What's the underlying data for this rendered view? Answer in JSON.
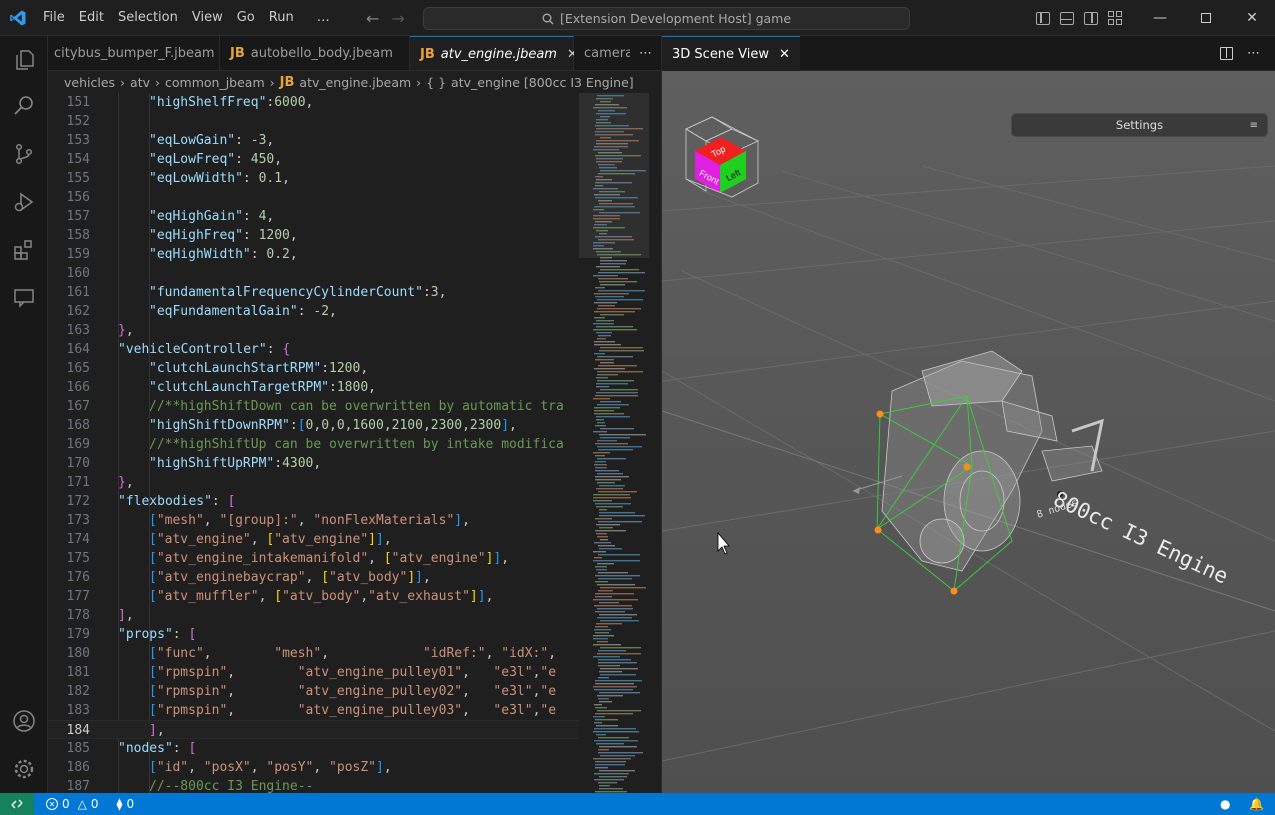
{
  "titlebar": {
    "menu": [
      "File",
      "Edit",
      "Selection",
      "View",
      "Go",
      "Run",
      "…"
    ],
    "command_center": "[Extension Development Host] game"
  },
  "editor": {
    "tabs": [
      {
        "label": "citybus_bumper_F.jbeam",
        "icon": "JB"
      },
      {
        "label": "autobello_body.jbeam",
        "icon": "JB"
      },
      {
        "label": "atv_engine.jbeam",
        "icon": "JB"
      },
      {
        "label": "camera",
        "icon": ""
      }
    ],
    "breadcrumb": [
      "vehicles",
      "atv",
      "common_jbeam",
      "atv_engine.jbeam",
      "atv_engine [800cc I3 Engine]"
    ],
    "breadcrumb_icons": {
      "file": "JB",
      "object": "{ }"
    },
    "current_line": 184,
    "lines": [
      {
        "n": 151,
        "i": 2,
        "t": [
          [
            "k",
            "\"highShelfFreq\""
          ],
          [
            "p",
            ":"
          ],
          [
            "n",
            "6000"
          ],
          [
            "p",
            ","
          ]
        ]
      },
      {
        "n": 152,
        "i": 0,
        "t": []
      },
      {
        "n": 153,
        "i": 2,
        "t": [
          [
            "k",
            "\"eqLowGain\""
          ],
          [
            "p",
            ": "
          ],
          [
            "n",
            "-3"
          ],
          [
            "p",
            ","
          ]
        ]
      },
      {
        "n": 154,
        "i": 2,
        "t": [
          [
            "k",
            "\"eqLowFreq\""
          ],
          [
            "p",
            ": "
          ],
          [
            "n",
            "450"
          ],
          [
            "p",
            ","
          ]
        ]
      },
      {
        "n": 155,
        "i": 2,
        "t": [
          [
            "k",
            "\"eqLowWidth\""
          ],
          [
            "p",
            ": "
          ],
          [
            "n",
            "0.1"
          ],
          [
            "p",
            ","
          ]
        ]
      },
      {
        "n": 156,
        "i": 0,
        "t": []
      },
      {
        "n": 157,
        "i": 2,
        "t": [
          [
            "k",
            "\"eqHighGain\""
          ],
          [
            "p",
            ": "
          ],
          [
            "n",
            "4"
          ],
          [
            "p",
            ","
          ]
        ]
      },
      {
        "n": 158,
        "i": 2,
        "t": [
          [
            "k",
            "\"eqHighFreq\""
          ],
          [
            "p",
            ": "
          ],
          [
            "n",
            "1200"
          ],
          [
            "p",
            ","
          ]
        ]
      },
      {
        "n": 159,
        "i": 2,
        "t": [
          [
            "k",
            "\"eqHighWidth\""
          ],
          [
            "p",
            ": "
          ],
          [
            "n",
            "0.2"
          ],
          [
            "p",
            ","
          ]
        ]
      },
      {
        "n": 160,
        "i": 0,
        "t": []
      },
      {
        "n": 161,
        "i": 2,
        "t": [
          [
            "k",
            "\"fundamentalFrequencyCylinderCount\""
          ],
          [
            "p",
            ":"
          ],
          [
            "n",
            "3"
          ],
          [
            "p",
            ","
          ]
        ]
      },
      {
        "n": 162,
        "i": 2,
        "t": [
          [
            "k",
            "\"eqFundamentalGain\""
          ],
          [
            "p",
            ": "
          ],
          [
            "n",
            "-2"
          ],
          [
            "p",
            ","
          ]
        ]
      },
      {
        "n": 163,
        "i": 1,
        "t": [
          [
            "b1",
            "}"
          ],
          [
            "p",
            ","
          ]
        ]
      },
      {
        "n": 164,
        "i": 1,
        "t": [
          [
            "k",
            "\"vehicleController\""
          ],
          [
            "p",
            ": "
          ],
          [
            "b1",
            "{"
          ]
        ]
      },
      {
        "n": 165,
        "i": 2,
        "t": [
          [
            "k",
            "\"clutchLaunchStartRPM\""
          ],
          [
            "p",
            ":"
          ],
          [
            "n",
            "1200"
          ],
          [
            "p",
            ","
          ]
        ]
      },
      {
        "n": 166,
        "i": 2,
        "t": [
          [
            "k",
            "\"clutchLaunchTargetRPM\""
          ],
          [
            "p",
            ":"
          ],
          [
            "n",
            "1800"
          ],
          [
            "p",
            ","
          ]
        ]
      },
      {
        "n": 167,
        "i": 2,
        "t": [
          [
            "c",
            "//**highShiftDown can be overwritten by automatic tra"
          ]
        ]
      },
      {
        "n": 168,
        "i": 2,
        "t": [
          [
            "k",
            "\"highShiftDownRPM\""
          ],
          [
            "p",
            ":"
          ],
          [
            "b2",
            "["
          ],
          [
            "n",
            "0,0,0,1600,2100,2300,2300"
          ],
          [
            "b2",
            "]"
          ],
          [
            "p",
            ","
          ]
        ]
      },
      {
        "n": 169,
        "i": 2,
        "t": [
          [
            "c",
            "//**highShiftUp can be overwritten by intake modifica"
          ]
        ]
      },
      {
        "n": 170,
        "i": 2,
        "t": [
          [
            "k",
            "\"highShiftUpRPM\""
          ],
          [
            "p",
            ":"
          ],
          [
            "n",
            "4300"
          ],
          [
            "p",
            ","
          ]
        ]
      },
      {
        "n": 171,
        "i": 1,
        "t": [
          [
            "b1",
            "}"
          ],
          [
            "p",
            ","
          ]
        ]
      },
      {
        "n": 172,
        "i": 1,
        "t": [
          [
            "k",
            "\"flexbodies\""
          ],
          [
            "p",
            ": "
          ],
          [
            "b1",
            "["
          ]
        ]
      },
      {
        "n": 173,
        "i": 2,
        "t": [
          [
            "b2",
            "["
          ],
          [
            "s",
            "\"mesh\""
          ],
          [
            "p",
            ", "
          ],
          [
            "s",
            "\"[group]:\""
          ],
          [
            "p",
            ", "
          ],
          [
            "s",
            "\"nonFlexMaterials\""
          ],
          [
            "b2",
            "]"
          ],
          [
            "p",
            ","
          ]
        ]
      },
      {
        "n": 174,
        "i": 2,
        "t": [
          [
            "b2",
            "["
          ],
          [
            "s",
            "\"atv_engine\""
          ],
          [
            "p",
            ", "
          ],
          [
            "b3",
            "["
          ],
          [
            "s",
            "\"atv_engine\""
          ],
          [
            "b3",
            "]"
          ],
          [
            "b2",
            "]"
          ],
          [
            "p",
            ","
          ]
        ]
      },
      {
        "n": 175,
        "i": 2,
        "t": [
          [
            "b2",
            "["
          ],
          [
            "s",
            "\"atv_engine_intakemanifold\""
          ],
          [
            "p",
            ", "
          ],
          [
            "b3",
            "["
          ],
          [
            "s",
            "\"atv_engine\""
          ],
          [
            "b3",
            "]"
          ],
          [
            "b2",
            "]"
          ],
          [
            "p",
            ","
          ]
        ]
      },
      {
        "n": 176,
        "i": 2,
        "t": [
          [
            "b2",
            "["
          ],
          [
            "s",
            "\"atv_enginebaycrap\""
          ],
          [
            "p",
            ", "
          ],
          [
            "b3",
            "["
          ],
          [
            "s",
            "\"atv_body\""
          ],
          [
            "b3",
            "]"
          ],
          [
            "b2",
            "]"
          ],
          [
            "p",
            ","
          ]
        ]
      },
      {
        "n": 177,
        "i": 2,
        "t": [
          [
            "b2",
            "["
          ],
          [
            "s",
            "\"atv_muffler\""
          ],
          [
            "p",
            ", "
          ],
          [
            "b3",
            "["
          ],
          [
            "s",
            "\"atv_body\""
          ],
          [
            "p",
            ","
          ],
          [
            "s",
            "\"atv_exhaust\""
          ],
          [
            "b3",
            "]"
          ],
          [
            "b2",
            "]"
          ],
          [
            "p",
            ","
          ]
        ]
      },
      {
        "n": 178,
        "i": 1,
        "t": [
          [
            "b1",
            "]"
          ],
          [
            "p",
            ","
          ]
        ]
      },
      {
        "n": 179,
        "i": 1,
        "t": [
          [
            "k",
            "\"props\""
          ],
          [
            "p",
            ": "
          ],
          [
            "b1",
            "["
          ]
        ]
      },
      {
        "n": 180,
        "i": 2,
        "t": [
          [
            "b2",
            "["
          ],
          [
            "s",
            "\"func\""
          ],
          [
            "p",
            ",        "
          ],
          [
            "s",
            "\"mesh\""
          ],
          [
            "p",
            ",            "
          ],
          [
            "s",
            "\"idRef:\""
          ],
          [
            "p",
            ", "
          ],
          [
            "s",
            "\"idX:\""
          ],
          [
            "p",
            ","
          ]
        ]
      },
      {
        "n": 181,
        "i": 2,
        "t": [
          [
            "b2",
            "["
          ],
          [
            "s",
            "\"rpmspin\""
          ],
          [
            "p",
            ",        "
          ],
          [
            "s",
            "\"atv_engine_pulley01\""
          ],
          [
            "p",
            ",   "
          ],
          [
            "s",
            "\"e3l\""
          ],
          [
            "p",
            ","
          ],
          [
            "s",
            "\"e"
          ]
        ]
      },
      {
        "n": 182,
        "i": 2,
        "t": [
          [
            "b2",
            "["
          ],
          [
            "s",
            "\"rpmspin\""
          ],
          [
            "p",
            ",        "
          ],
          [
            "s",
            "\"atv_engine_pulley02\""
          ],
          [
            "p",
            ",   "
          ],
          [
            "s",
            "\"e3l\""
          ],
          [
            "p",
            ","
          ],
          [
            "s",
            "\"e"
          ]
        ]
      },
      {
        "n": 183,
        "i": 2,
        "t": [
          [
            "b2",
            "["
          ],
          [
            "s",
            "\"rpmspin\""
          ],
          [
            "p",
            ",        "
          ],
          [
            "s",
            "\"atv_engine_pulley03\""
          ],
          [
            "p",
            ",   "
          ],
          [
            "s",
            "\"e3l\""
          ],
          [
            "p",
            ","
          ],
          [
            "s",
            "\"e"
          ]
        ]
      },
      {
        "n": 184,
        "i": 2,
        "t": [
          [
            "b1",
            "]"
          ],
          [
            "p",
            ","
          ]
        ]
      },
      {
        "n": 185,
        "i": 1,
        "t": [
          [
            "k",
            "\"nodes\""
          ],
          [
            "p",
            ": "
          ],
          [
            "b1",
            "["
          ]
        ]
      },
      {
        "n": 186,
        "i": 2,
        "t": [
          [
            "b2",
            "["
          ],
          [
            "s",
            "\"id\""
          ],
          [
            "p",
            ", "
          ],
          [
            "s",
            "\"posX\""
          ],
          [
            "p",
            ", "
          ],
          [
            "s",
            "\"posY\""
          ],
          [
            "p",
            ", "
          ],
          [
            "s",
            "\"posZ\""
          ],
          [
            "b2",
            "]"
          ],
          [
            "p",
            ","
          ]
        ]
      },
      {
        "n": 187,
        "i": 2,
        "t": [
          [
            "c",
            "//--800cc I3 Engine--"
          ]
        ]
      }
    ]
  },
  "scene": {
    "tab_label": "3D Scene View",
    "settings_label": "Settings",
    "gizmo": {
      "top": "Top",
      "front": "Front",
      "left": "Left"
    },
    "label_main": "800cc I3 Engine",
    "label_sub": "8 nodes"
  },
  "statusbar": {
    "errors": "0",
    "warnings": "0",
    "ports": "0"
  },
  "colors": {
    "accent": "#0078d4",
    "remote": "#16825d",
    "jb_icon": "#e8a33d"
  }
}
